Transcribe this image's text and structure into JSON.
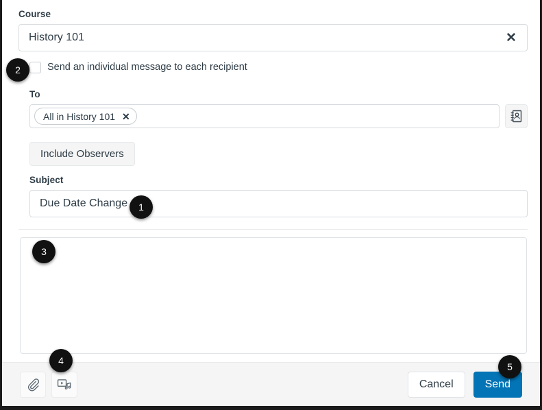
{
  "dialog": {
    "name": "compose-message"
  },
  "course": {
    "label": "Course",
    "value": "History 101",
    "clear_icon": "close-icon",
    "clear_glyph": "✕"
  },
  "individual_message": {
    "label": "Send an individual message to each recipient",
    "checked": false
  },
  "to": {
    "label": "To",
    "recipients": [
      {
        "label": "All in History 101",
        "remove_glyph": "✕"
      }
    ],
    "address_book_icon": "address-book-icon"
  },
  "include_observers": {
    "label": "Include Observers"
  },
  "subject": {
    "label": "Subject",
    "value": "Due Date Change"
  },
  "message": {
    "value": "",
    "placeholder": ""
  },
  "footer": {
    "attachment_icon": "paperclip-icon",
    "media_icon": "media-comment-icon",
    "cancel_label": "Cancel",
    "send_label": "Send"
  },
  "annotations": [
    {
      "id": "1",
      "label": "1",
      "target": "subject-field"
    },
    {
      "id": "2",
      "label": "2",
      "target": "individual-message-checkbox"
    },
    {
      "id": "3",
      "label": "3",
      "target": "message-body"
    },
    {
      "id": "4",
      "label": "4",
      "target": "attachment-tools"
    },
    {
      "id": "5",
      "label": "5",
      "target": "send-button"
    }
  ],
  "colors": {
    "brand_blue": "#0374B5",
    "text": "#2D3B45",
    "border": "#d7dade",
    "footer_bg": "#f5f5f5",
    "badge_bg": "#111111"
  }
}
